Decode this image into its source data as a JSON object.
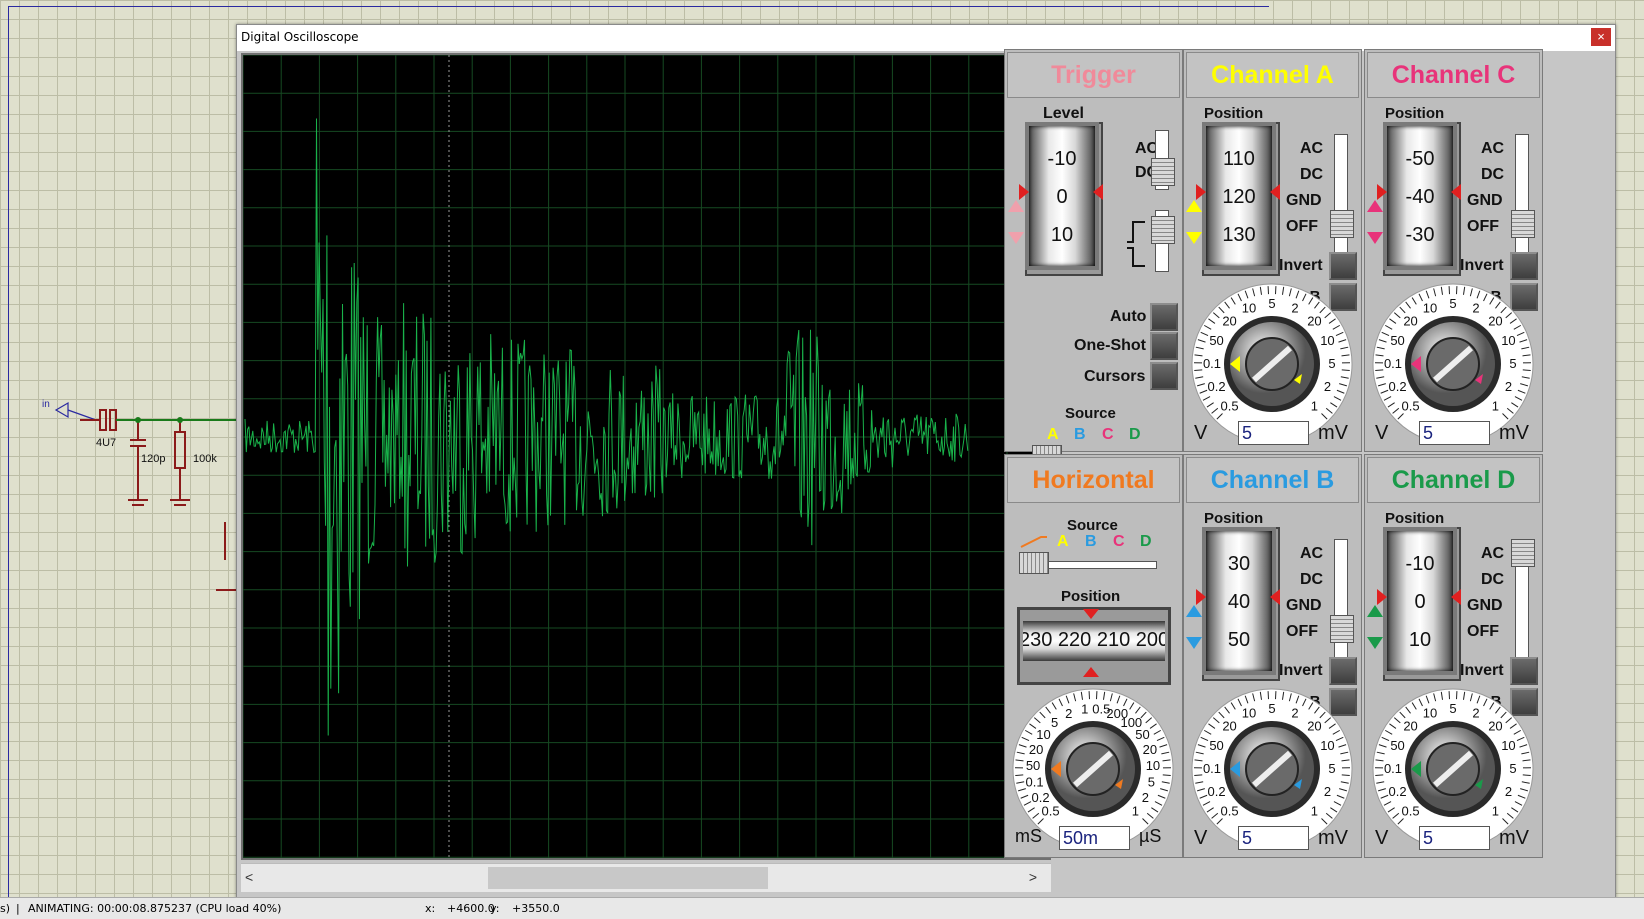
{
  "window": {
    "title": "Digital Oscilloscope",
    "close_label": "×"
  },
  "trigger": {
    "title": "Trigger",
    "level_label": "Level",
    "drum": [
      "-10",
      "0",
      "10"
    ],
    "coupling": [
      "AC",
      "DC"
    ],
    "buttons": [
      "Auto",
      "One-Shot",
      "Cursors"
    ],
    "source_label": "Source",
    "source_letters": [
      "A",
      "B",
      "C",
      "D"
    ]
  },
  "channel_a": {
    "title": "Channel A",
    "position_label": "Position",
    "drum": [
      "110",
      "120",
      "130"
    ],
    "coupling": [
      "AC",
      "DC",
      "GND",
      "OFF"
    ],
    "invert": "Invert",
    "aplusb": "A+B",
    "volts": "5",
    "unit_left": "V",
    "unit_right": "mV",
    "color": "#ffff00"
  },
  "channel_c": {
    "title": "Channel C",
    "position_label": "Position",
    "drum": [
      "-50",
      "-40",
      "-30"
    ],
    "coupling": [
      "AC",
      "DC",
      "GND",
      "OFF"
    ],
    "invert": "Invert",
    "aplusb": "A+B",
    "volts": "5",
    "unit_left": "V",
    "unit_right": "mV",
    "color": "#e8337a"
  },
  "channel_b": {
    "title": "Channel B",
    "position_label": "Position",
    "drum": [
      "30",
      "40",
      "50"
    ],
    "coupling": [
      "AC",
      "DC",
      "GND",
      "OFF"
    ],
    "invert": "Invert",
    "aplusb": "A+B",
    "volts": "5",
    "unit_left": "V",
    "unit_right": "mV",
    "color": "#2a9be0"
  },
  "channel_d": {
    "title": "Channel D",
    "position_label": "Position",
    "drum": [
      "-10",
      "0",
      "10"
    ],
    "coupling": [
      "AC",
      "DC",
      "GND",
      "OFF"
    ],
    "invert": "Invert",
    "aplusb": "A+B",
    "volts": "5",
    "unit_left": "V",
    "unit_right": "mV",
    "color": "#1a9a4a"
  },
  "horizontal": {
    "title": "Horizontal",
    "source_label": "Source",
    "source_letters": [
      "A",
      "B",
      "C",
      "D"
    ],
    "position_label": "Position",
    "dial": "230 220 210 200",
    "timebase": "50m",
    "unit_left": "mS",
    "unit_right": "µS"
  },
  "volt_scale": [
    "0.5",
    "0.2",
    "0.1",
    "50",
    "20",
    "10",
    "5",
    "2",
    "20",
    "10",
    "5",
    "2",
    "1"
  ],
  "time_scale": [
    "0.5",
    "0.2",
    "0.1",
    "50",
    "20",
    "10",
    "5",
    "2",
    "1",
    "0.5",
    "200",
    "100",
    "50",
    "20",
    "10",
    "5",
    "2",
    "1"
  ],
  "schematic": {
    "probe": "in",
    "c1": "4U7",
    "c2": "120p",
    "r1": "100k"
  },
  "status": {
    "sim": "ANIMATING: 00:00:08.875237 (CPU load 40%)",
    "left_frag": "s)",
    "x_label": "x:",
    "x": "+4600.0",
    "y_label": "y:",
    "y": "+3550.0"
  },
  "colors": {
    "trigger": "#f08a9a",
    "horizontal": "#f07a20",
    "trace": "#19b24a",
    "grid": "#1a5a2a"
  }
}
